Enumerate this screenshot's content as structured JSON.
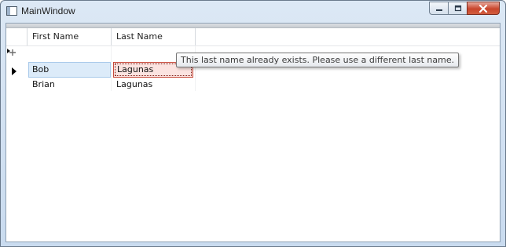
{
  "window": {
    "title": "MainWindow",
    "icon": "window-app-icon",
    "caption_buttons": [
      "minimize-icon",
      "maximize-icon",
      "close-icon"
    ]
  },
  "grid": {
    "columns": [
      "First Name",
      "Last Name"
    ],
    "new_row_icon": "new-row-pencil-icon",
    "current_row_icon": "current-row-arrow-icon",
    "rows": [
      {
        "first_name": "Bob",
        "last_name": "Lagunas",
        "state": "editing"
      },
      {
        "first_name": "Brian",
        "last_name": "Lagunas",
        "state": "normal"
      }
    ]
  },
  "tooltip": {
    "text": "This last name already exists.  Please use a different last name."
  },
  "colors": {
    "selected_cell": "#dcebf9",
    "error_cell": "#fbe3e0",
    "error_border": "#c74a3b",
    "close_button": "#c8452c"
  }
}
